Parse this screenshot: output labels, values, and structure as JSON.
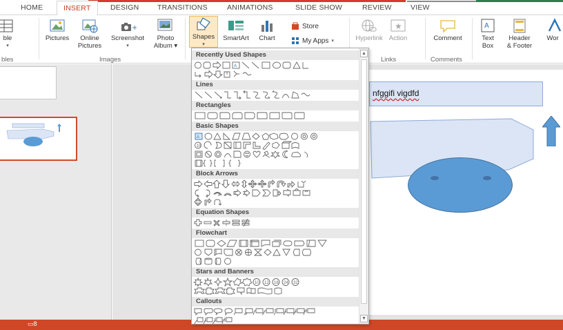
{
  "ribbon": {
    "tabs": [
      "HOME",
      "INSERT",
      "DESIGN",
      "TRANSITIONS",
      "ANIMATIONS",
      "SLIDE SHOW",
      "REVIEW",
      "VIEW"
    ],
    "active_tab": "INSERT",
    "buttons": {
      "table": "ble",
      "pictures": "Pictures",
      "online_pictures_1": "Online",
      "online_pictures_2": "Pictures",
      "screenshot": "Screenshot",
      "photo_album_1": "Photo",
      "photo_album_2": "Album",
      "shapes": "Shapes",
      "smartart": "SmartArt",
      "chart": "Chart",
      "store": "Store",
      "my_apps": "My Apps",
      "hyperlink": "Hyperlink",
      "action": "Action",
      "comment": "Comment",
      "text_box_1": "Text",
      "text_box_2": "Box",
      "header_footer_1": "Header",
      "header_footer_2": "& Footer",
      "wordart": "Wor"
    },
    "groups": {
      "tables": "bles",
      "images": "Images",
      "links": "Links",
      "comments": "Comments"
    }
  },
  "shapes_menu": {
    "sections": [
      "Recently Used Shapes",
      "Lines",
      "Rectangles",
      "Basic Shapes",
      "Block Arrows",
      "Equation Shapes",
      "Flowchart",
      "Stars and Banners",
      "Callouts"
    ]
  },
  "slide": {
    "title_text": "nfggifi vigdfd"
  },
  "colors": {
    "accent": "#d04727",
    "shape_fill": "#5b9bd5",
    "title_fill": "#dbe5f5"
  }
}
